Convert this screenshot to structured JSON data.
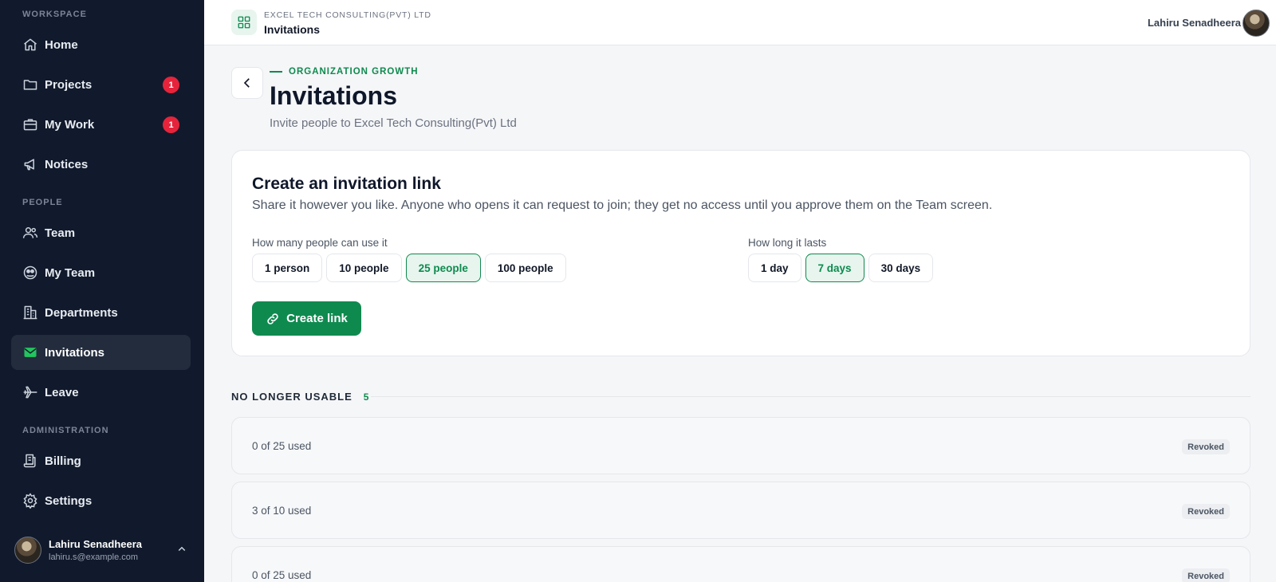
{
  "sidebar": {
    "section_workspace": "WORKSPACE",
    "section_people": "PEOPLE",
    "section_admin": "ADMINISTRATION",
    "items": [
      {
        "label": "Home",
        "icon": "home-icon"
      },
      {
        "label": "Projects",
        "icon": "folder-icon",
        "badge": "1"
      },
      {
        "label": "My Work",
        "icon": "briefcase-icon",
        "badge": "1"
      },
      {
        "label": "Notices",
        "icon": "megaphone-icon"
      },
      {
        "label": "Team",
        "icon": "users-icon"
      },
      {
        "label": "My Team",
        "icon": "team-icon"
      },
      {
        "label": "Departments",
        "icon": "building-icon"
      },
      {
        "label": "Invitations",
        "icon": "mail-icon",
        "active": true
      },
      {
        "label": "Leave",
        "icon": "plane-icon"
      },
      {
        "label": "Billing",
        "icon": "receipt-icon"
      },
      {
        "label": "Settings",
        "icon": "gear-icon"
      }
    ],
    "user": {
      "name": "Lahiru Senadheera",
      "email": "lahiru.s@example.com"
    }
  },
  "header": {
    "org_name": "EXCEL TECH CONSULTING(PVT) LTD",
    "crumb": "Invitations",
    "user_name": "Lahiru Senadheera"
  },
  "page": {
    "eyebrow": "ORGANIZATION GROWTH",
    "title": "Invitations",
    "subtitle": "Invite people to Excel Tech Consulting(Pvt) Ltd"
  },
  "card": {
    "title": "Create an invitation link",
    "description": "Share it however you like. Anyone who opens it can request to join; they get no access until you approve them on the Team screen.",
    "people_label": "How many people can use it",
    "people_options": [
      "1 person",
      "10 people",
      "25 people",
      "100 people"
    ],
    "people_selected": "25 people",
    "duration_label": "How long it lasts",
    "duration_options": [
      "1 day",
      "7 days",
      "30 days"
    ],
    "duration_selected": "7 days",
    "create_label": "Create link"
  },
  "list": {
    "title": "NO LONGER USABLE",
    "count": "5",
    "rows": [
      {
        "usage": "0 of 25 used",
        "status": "Revoked"
      },
      {
        "usage": "3 of 10 used",
        "status": "Revoked"
      },
      {
        "usage": "0 of 25 used",
        "status": "Revoked"
      }
    ]
  },
  "colors": {
    "sidebar_bg": "#111a2c",
    "accent": "#0f8a4f",
    "badge_red": "#e5243b",
    "active_icon": "#22c55e"
  }
}
